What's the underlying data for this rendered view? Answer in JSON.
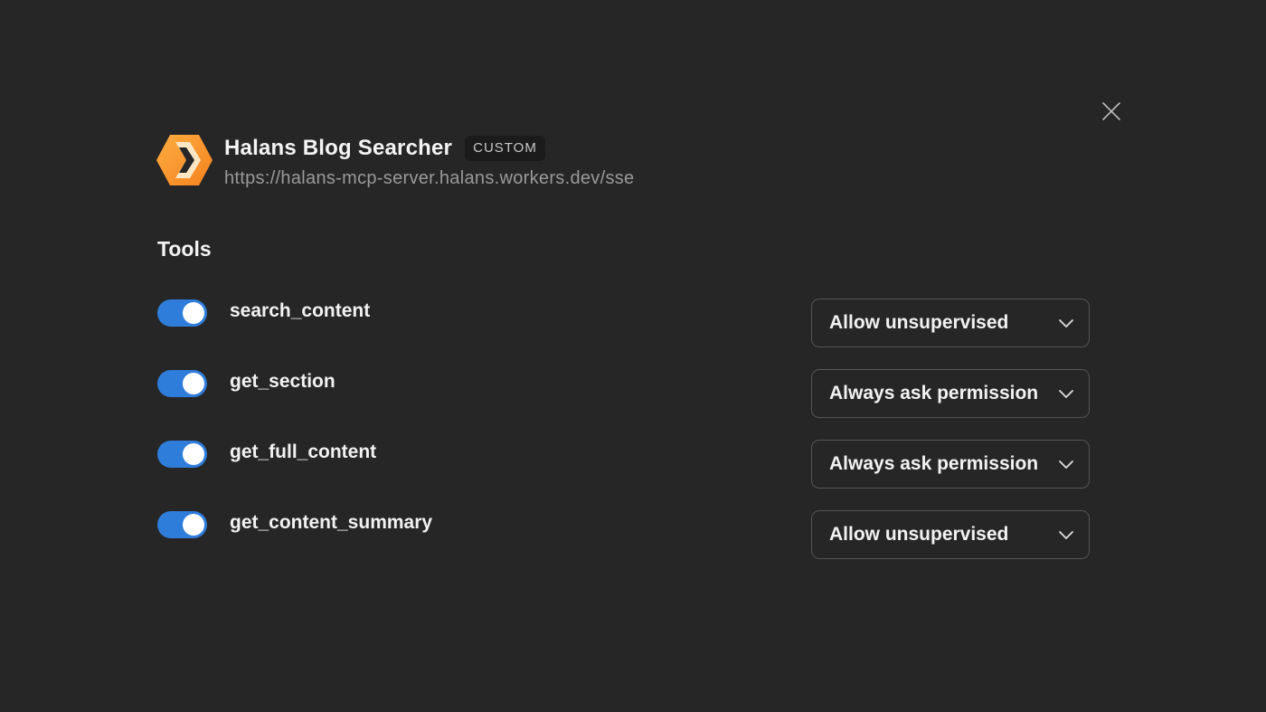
{
  "server": {
    "name": "Halans Blog Searcher",
    "badge": "CUSTOM",
    "url": "https://halans-mcp-server.halans.workers.dev/sse",
    "logo_icon": "cloudflare-hexagon-logo",
    "logo_colors": [
      "#f6821f",
      "#fbad41"
    ]
  },
  "tools_section": {
    "title": "Tools",
    "tools": [
      {
        "name": "search_content",
        "enabled": true,
        "permission": "Allow unsupervised"
      },
      {
        "name": "get_section",
        "enabled": true,
        "permission": "Always ask permission"
      },
      {
        "name": "get_full_content",
        "enabled": true,
        "permission": "Always ask permission"
      },
      {
        "name": "get_content_summary",
        "enabled": true,
        "permission": "Allow unsupervised"
      }
    ]
  },
  "colors": {
    "background": "#262626",
    "toggle_on": "#2f7ddb",
    "url_text": "#9a9a9a"
  },
  "icons": {
    "close": "close-icon",
    "dropdown": "chevron-down-icon"
  }
}
